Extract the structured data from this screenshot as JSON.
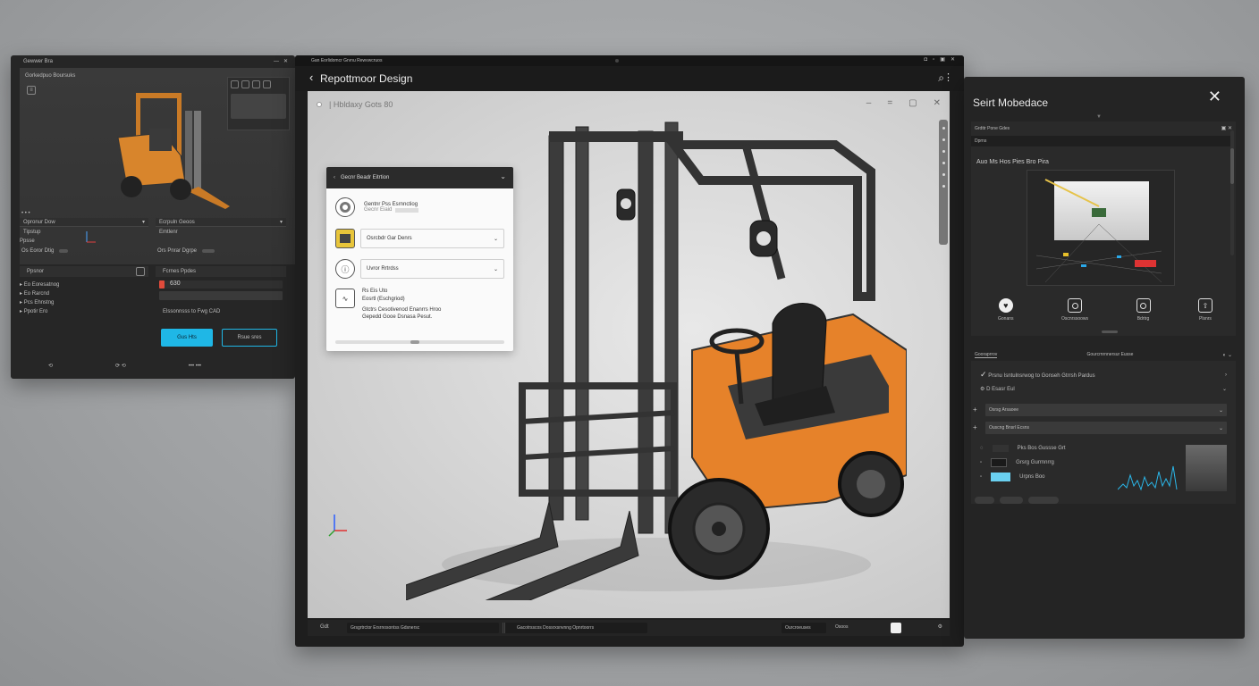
{
  "left_window": {
    "title": "Gewwer Bra",
    "viewport_label": "Gorkedpuo Boursuks",
    "list_a": {
      "header": "Opronur Dow",
      "sub": "Tipstup",
      "caption": "Ppsse",
      "item": "Os Eoror Dtig"
    },
    "list_b": {
      "header": "Ecrpuln Geoos",
      "sub": "Emtlenr",
      "item": "Ors Pnrar Dgrpe"
    },
    "tree": {
      "header": "Ppsnor",
      "items": [
        "Eo Eoresatnog",
        "Eo Rarcnd",
        "Pcs Ehnstng",
        "Ppotir Ero"
      ]
    },
    "form": {
      "header": "Fcrnes Ppdes",
      "value": "630",
      "note": "Elssonnsss to Fwg CAD"
    },
    "primary_button": "Gus Hts",
    "secondary_button": "Rsue sres"
  },
  "main_window": {
    "topbar_text": "Gan Eorlidomcr Grvnu Rewvwcruos",
    "title": "Repottmoor Design",
    "viewport_caption": "Hbldaxy Gots 80",
    "props_panel": {
      "header": "Gecnr Beadr Eitrtion",
      "item1_title": "Gentnr Pss Esrnnctiog",
      "item1_sub": "Gecnr Eiaid",
      "select1": "Osrcbdr Gar Denrs",
      "select2": "Uvror Rrtrdss",
      "item4_line1": "Rs Eis Uto",
      "item4_line2": "Eosrtl (Eschgriod)",
      "item4_line3": "Gtctrs Cesotivenod Enanrrs Hroo",
      "item4_line4": "Gepedd Gooe Dsnasa Pesut."
    },
    "status": {
      "left": "Gdt",
      "field1": "Grsgrtrctor Ersrnosontss Gdsnersc",
      "field2": "Gacotrsscos Dossrxsnvnng Opnrtoorrs",
      "field3": "Ourcroeuses",
      "field4": "Osoos"
    }
  },
  "right_window": {
    "title": "Seirt Mobedace",
    "crumb1": "Grdttr Pone Gdes",
    "crumb2": "Dprns",
    "preview_label": "Auo Ms Hos Pies Bro Pira",
    "actions": [
      "Gonans",
      "Oscnrssoows",
      "Bdrtrg",
      "Plsnrs"
    ],
    "tabs": {
      "left": "Gooraprrov",
      "right": "Gourcrnrnnersur Eusse"
    },
    "rows": [
      "Prsnu Isntulnsrwog to Gonseh Gtrrsh Pardus",
      "D Esasr Eul",
      "Osrsg Arsaoee",
      "Ouscng Bnsrl Ecsns"
    ],
    "layers": [
      "Pks Bos Gussse Grt",
      "Grsrg Gurrnnrrg",
      "Urpns Boo"
    ]
  }
}
